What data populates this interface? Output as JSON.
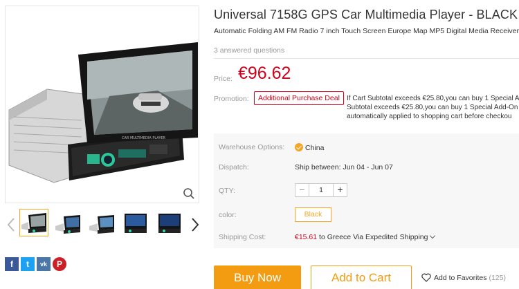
{
  "product": {
    "title": "Universal 7158G GPS Car Multimedia Player - BLACK",
    "subtitle": "Automatic Folding AM FM Radio 7 inch Touch Screen Europe Map MP5 Digital Media Receiver",
    "answered": "3 answered questions",
    "price_label": "Price:",
    "price": "€96.62",
    "screen_text": "CAR MULTIMEDIA PLAYER"
  },
  "promotion": {
    "label": "Promotion:",
    "badge": "Additional Purchase Deal",
    "lines": [
      "If Cart Subtotal exceeds €25.80,you can buy 1 Special A",
      "Subtotal exceeds €25.80,you can buy 1 Special Add-On",
      "automatically applied to shopping cart before checkou"
    ]
  },
  "options": {
    "warehouse_label": "Warehouse Options:",
    "warehouse_value": "China",
    "dispatch_label": "Dispatch:",
    "dispatch_value": "Ship between: Jun 04 - Jun 07",
    "qty_label": "QTY:",
    "qty_minus": "−",
    "qty_value": "1",
    "qty_plus": "+",
    "color_label": "color:",
    "color_value": "Black",
    "shipping_label": "Shipping Cost:",
    "shipping_price": "€15.61",
    "shipping_text": " to Greece Via Expedited Shipping"
  },
  "actions": {
    "buy_now": "Buy Now",
    "add_to_cart": "Add to Cart",
    "favorites": "Add to Favorites",
    "favorites_count": "(125)"
  },
  "share": {
    "facebook": "f",
    "twitter": "t",
    "vk": "vk",
    "pinterest": "P"
  },
  "colors": {
    "price_red": "#d0021b",
    "accent_orange": "#f39c12"
  }
}
